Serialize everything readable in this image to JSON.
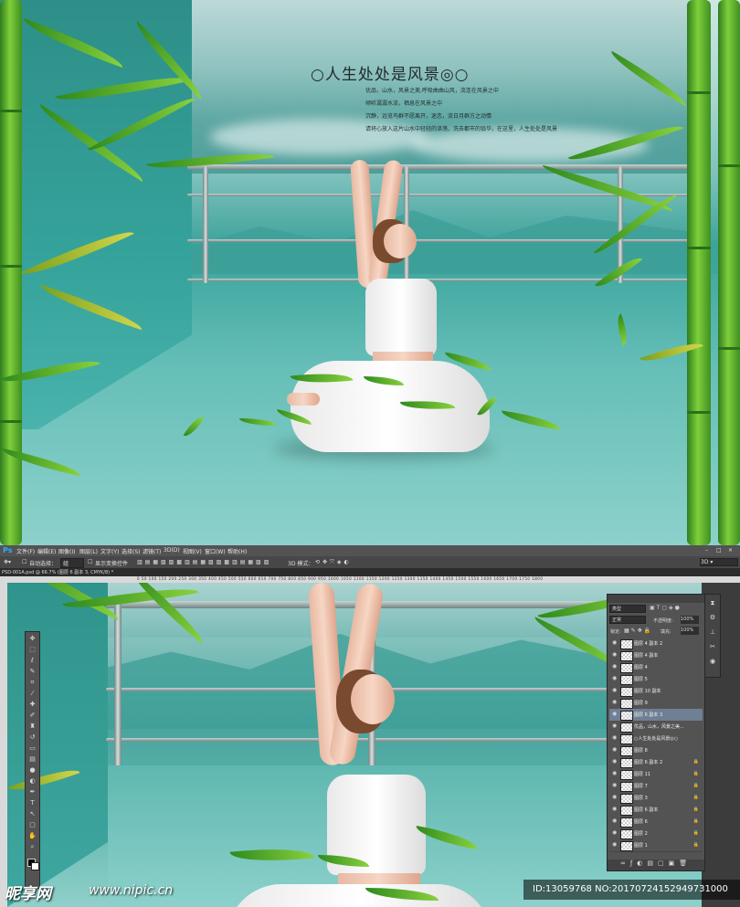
{
  "poster": {
    "title": "○人生处处是风景◎○",
    "poem": [
      "优品，山水，风景之美,呼吸曲曲山风，流连在风景之中",
      "倾听潺潺水流，栖息在风景之中",
      "沉静，远览鸟群不愿离开，迷恋，流日月群方之动情",
      "请将心放入这片山水中轻轻的涤荡，洗去都市的铅华，在这里，人生处处是风景"
    ]
  },
  "photoshop": {
    "logo": "Ps",
    "menu": [
      "文件(F)",
      "编辑(E)",
      "图像(I)",
      "图层(L)",
      "文字(Y)",
      "选择(S)",
      "滤镜(T)",
      "3D(D)",
      "视图(V)",
      "窗口(W)",
      "帮助(H)"
    ],
    "options": {
      "auto_select": "自动选择：",
      "auto_select_value": "组",
      "show_transform": "显示变换控件",
      "mode_3d": "3D 模式："
    },
    "doc_tab": "PSD-001A.psd @ 66.7% (图层 6 副本 3, CMYK/8) *",
    "ruler": "0 50 100 150 200 250 300 350 400 450 500 550 600 650 700 750 800 850 900 950 1000 1050 1100 1150 1200 1250 1300 1350 1400 1450 1500 1550 1600 1650 1700 1750 1800",
    "layers_panel": {
      "kind_label": "类型",
      "blend_mode": "正常",
      "opacity_label": "不透明度:",
      "opacity_value": "100%",
      "lock_label": "锁定:",
      "fill_label": "填充:",
      "fill_value": "100%",
      "layers": [
        {
          "name": "图层 4 副本 2",
          "locked": false,
          "selected": false
        },
        {
          "name": "图层 4 副本",
          "locked": false,
          "selected": false
        },
        {
          "name": "图层 4",
          "locked": false,
          "selected": false
        },
        {
          "name": "图层 5",
          "locked": false,
          "selected": false
        },
        {
          "name": "图层 10 副本",
          "locked": false,
          "selected": false
        },
        {
          "name": "图层 9",
          "locked": false,
          "selected": false
        },
        {
          "name": "图层 6 副本 3",
          "locked": false,
          "selected": true
        },
        {
          "name": "优品，山水，风景之美...",
          "locked": false,
          "selected": false
        },
        {
          "name": "○人生处处是风景◎○",
          "locked": false,
          "selected": false
        },
        {
          "name": "图层 8",
          "locked": false,
          "selected": false
        },
        {
          "name": "图层 6 副本 2",
          "locked": true,
          "selected": false
        },
        {
          "name": "图层 11",
          "locked": true,
          "selected": false
        },
        {
          "name": "图层 7",
          "locked": true,
          "selected": false
        },
        {
          "name": "图层 3",
          "locked": true,
          "selected": false
        },
        {
          "name": "图层 6 副本",
          "locked": true,
          "selected": false
        },
        {
          "name": "图层 6",
          "locked": true,
          "selected": false
        },
        {
          "name": "图层 2",
          "locked": true,
          "selected": false
        },
        {
          "name": "图层 1",
          "locked": true,
          "selected": false
        }
      ]
    }
  },
  "watermark": {
    "logo": "昵享网",
    "url": "www.nipic.cn",
    "id_line": "ID:13059768 NO:20170724152949731000"
  }
}
